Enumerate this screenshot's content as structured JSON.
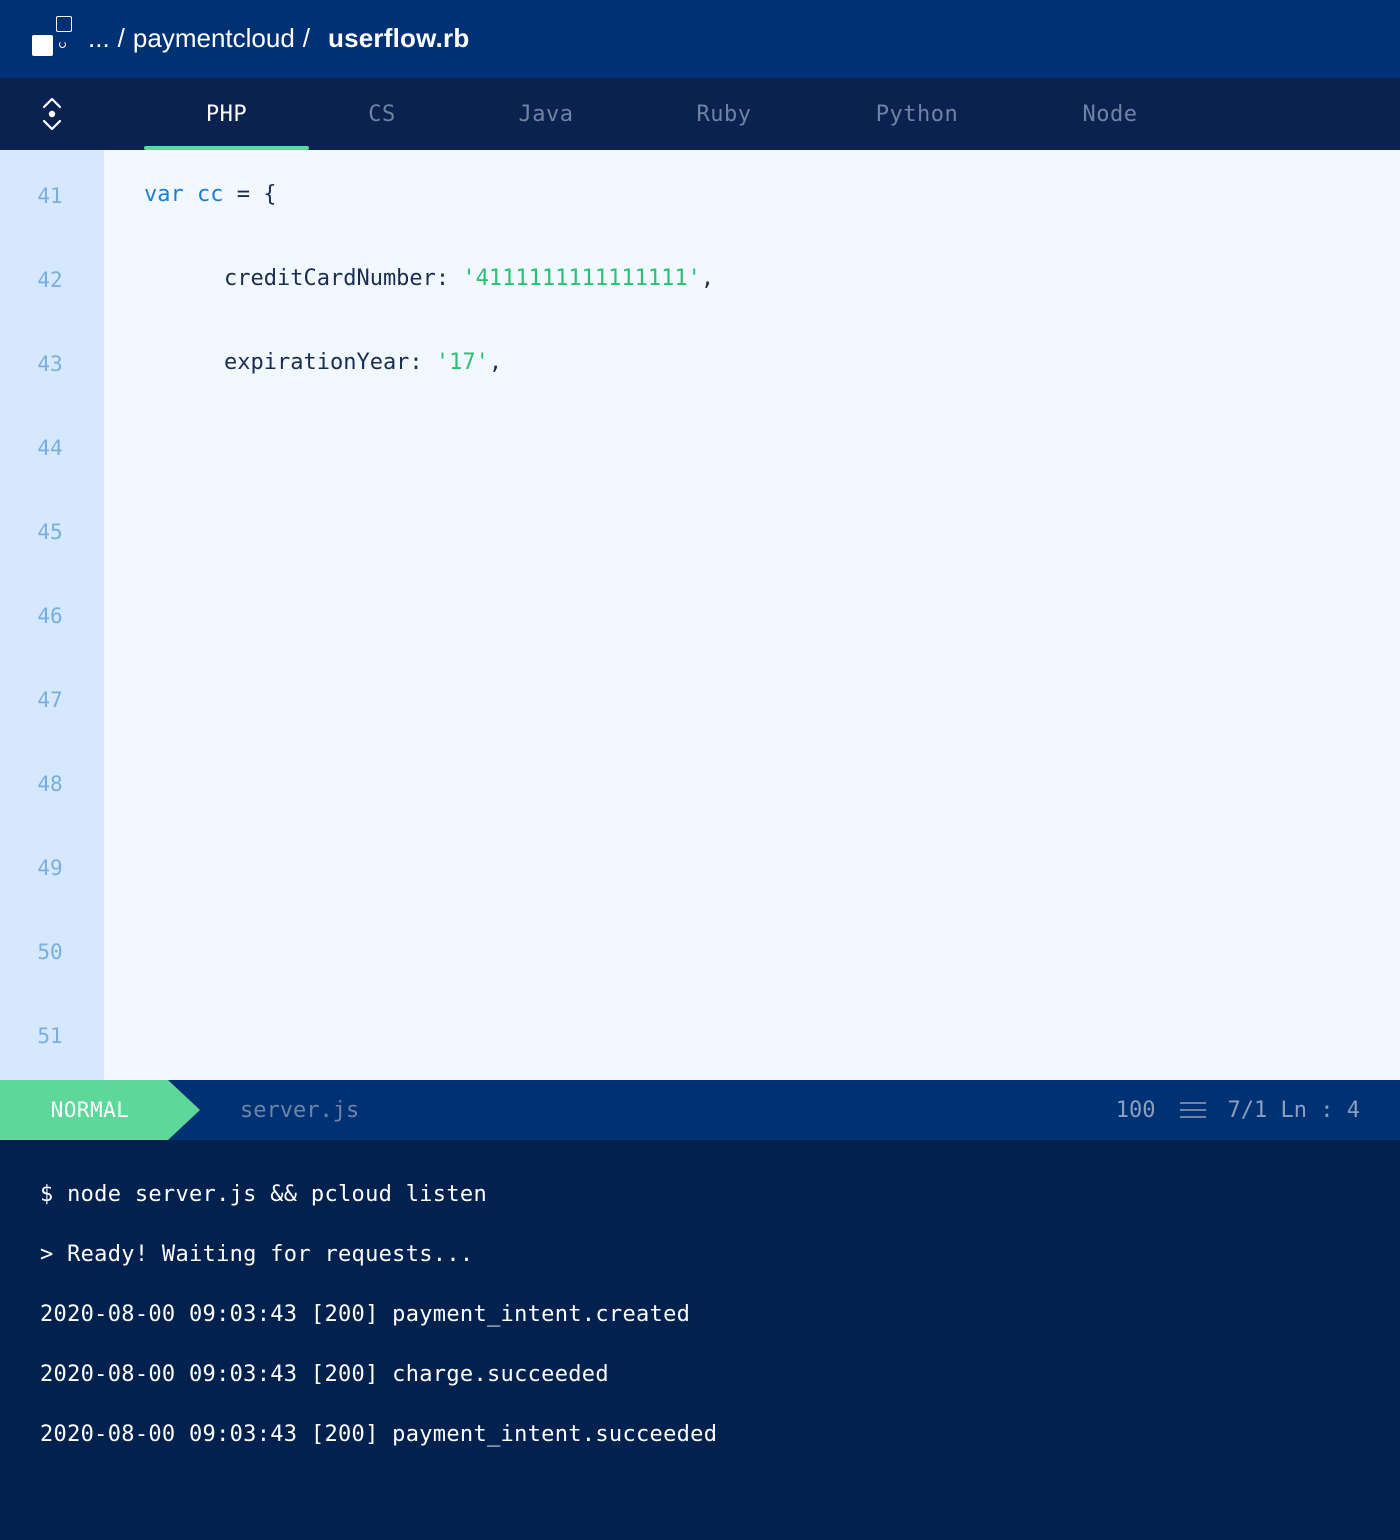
{
  "titlebar": {
    "logo_icon": "app-logo-icon",
    "breadcrumb_ellipsis": "...",
    "breadcrumb_folder": "paymentcloud",
    "breadcrumb_separator": "/",
    "file_name": "userflow.rb"
  },
  "tabs": [
    {
      "label": "PHP",
      "active": true
    },
    {
      "label": "CS",
      "active": false
    },
    {
      "label": "Java",
      "active": false
    },
    {
      "label": "Ruby",
      "active": false
    },
    {
      "label": "Python",
      "active": false
    },
    {
      "label": "Node",
      "active": false
    }
  ],
  "editor": {
    "line_numbers": [
      "41",
      "42",
      "43",
      "44",
      "45",
      "46",
      "47",
      "48",
      "49",
      "50",
      "51"
    ],
    "code": {
      "line1_keyword": "var cc",
      "line1_rest": " = {",
      "line2_key": "creditCardNumber: ",
      "line2_value": "'4111111111111111'",
      "line2_punct": ",",
      "line3_key": "expirationYear: ",
      "line3_value": "'17'",
      "line3_punct": ","
    }
  },
  "statusbar": {
    "mode": "NORMAL",
    "file": "server.js",
    "percent": "100",
    "position": "7/1 Ln : 4",
    "menu_icon": "menu-lines-icon"
  },
  "terminal": {
    "lines": [
      "$ node server.js && pcloud listen",
      "> Ready! Waiting for requests...",
      "2020-08-00 09:03:43 [200] payment_intent.created",
      "2020-08-00 09:03:43 [200] charge.succeeded",
      "2020-08-00 09:03:43 [200] payment_intent.succeeded"
    ]
  },
  "colors": {
    "titlebar_bg": "#003174",
    "tabbar_bg": "#0b2150",
    "active_tab_underline": "#5ed79a",
    "editor_bg": "#f1f8ff",
    "gutter_bg": "#d6e8fd",
    "keyword": "#1b7fcf",
    "string": "#2bc06f",
    "mode_bg": "#5ed79a",
    "terminal_bg": "#02214f"
  }
}
